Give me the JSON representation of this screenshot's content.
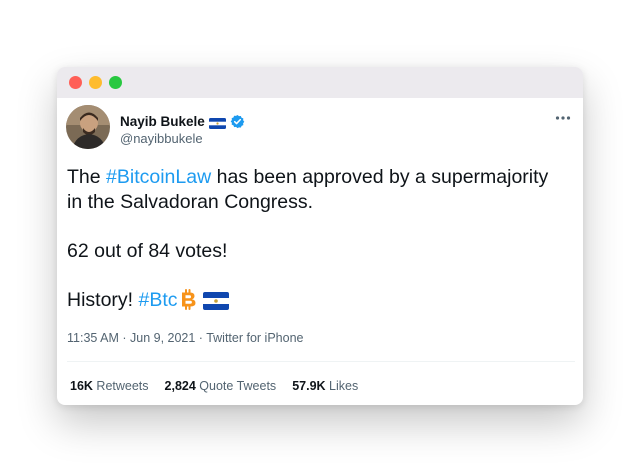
{
  "window": {
    "controls": [
      "close",
      "minimize",
      "zoom"
    ]
  },
  "tweet": {
    "author_name": "Nayib Bukele",
    "handle": "@nayibbukele",
    "avatar_icon": "profile-photo",
    "flag_icon": "el-salvador-flag",
    "verified_icon": "verified-badge-icon",
    "verified_color": "#1d9bf0",
    "more_icon": "more-icon",
    "text": {
      "line1_pre": "The ",
      "line1_hashtag": "#BitcoinLaw",
      "line1_post": " has been approved by a supermajority",
      "line2": "in the Salvadoran Congress.",
      "line3": "62 out of 84 votes!",
      "line4_pre": "History! ",
      "line4_hashtag": "#Btc"
    },
    "emoji": [
      "bitcoin-icon",
      "el-salvador-flag"
    ],
    "timestamp": "11:35 AM · Jun 9, 2021 · Twitter for iPhone",
    "stats": {
      "retweets_count": "16K",
      "retweets_label": " Retweets",
      "quotes_count": "2,824",
      "quotes_label": " Quote Tweets",
      "likes_count": "57.9K",
      "likes_label": " Likes"
    },
    "colors": {
      "hashtag": "#1d9bf0",
      "text": "#0f1419",
      "secondary": "#536471"
    }
  }
}
